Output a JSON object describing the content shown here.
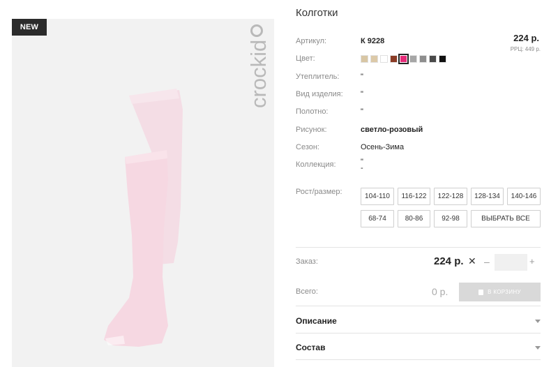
{
  "badge": "NEW",
  "brand": "crockid",
  "product": {
    "title": "Колготки",
    "price": "224 р.",
    "rrp": "РРЦ: 449 р."
  },
  "attributes": [
    {
      "label": "Артикул:",
      "value": "К 9228",
      "bold": true
    },
    {
      "label": "Цвет:",
      "value": ""
    },
    {
      "label": "Утеплитель:",
      "value": "\""
    },
    {
      "label": "Вид изделия:",
      "value": "\""
    },
    {
      "label": "Полотно:",
      "value": "\""
    },
    {
      "label": "Рисунок:",
      "value": "светло-розовый",
      "bold": true
    },
    {
      "label": "Сезон:",
      "value": "Осень-Зима"
    },
    {
      "label": "Коллекция:",
      "value": "\""
    }
  ],
  "colors": {
    "swatches": [
      "#d8c6a4",
      "#dcc9a8",
      "#ffffff",
      "#8b3c26",
      "#e52a78",
      "#a6a6a6",
      "#8e8e8e",
      "#4a4a4a",
      "#111111"
    ],
    "selected_index": 4,
    "accent_pink": "#e52a78"
  },
  "sizes": {
    "label": "Рост/размер:",
    "options": [
      "104-110",
      "116-122",
      "122-128",
      "128-134",
      "140-146",
      "68-74",
      "80-86",
      "92-98"
    ],
    "select_all": "ВЫБРАТЬ ВСЕ"
  },
  "order": {
    "label": "Заказ:",
    "price": "224 р.",
    "times": "✕",
    "minus": "–",
    "plus": "+",
    "quantity": ""
  },
  "total": {
    "label": "Всего:",
    "value": "0 р.",
    "cart_button": "В КОРЗИНУ"
  },
  "accordions": [
    {
      "label": "Описание"
    },
    {
      "label": "Состав"
    }
  ]
}
